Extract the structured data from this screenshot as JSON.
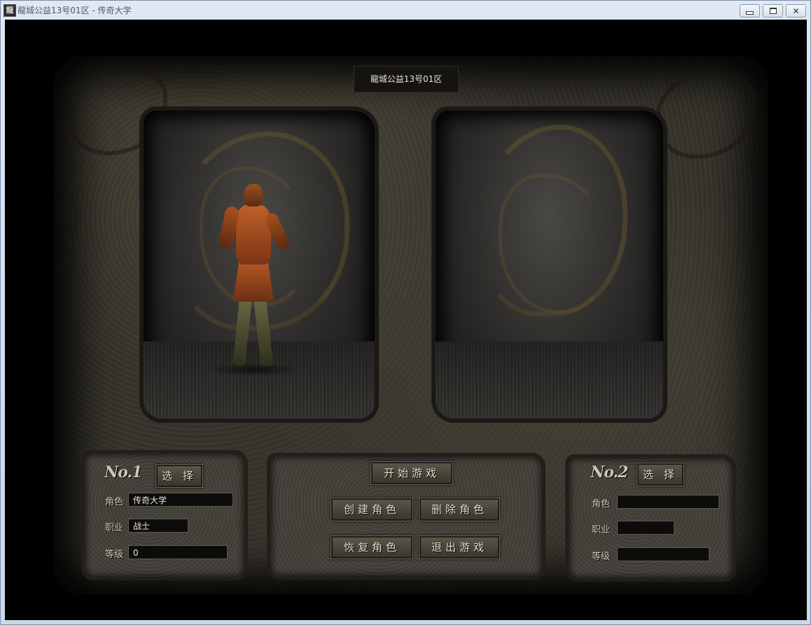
{
  "window": {
    "title": "龍城公益13号01区 - 传奇大学",
    "icon_glyph": "龍",
    "controls": {
      "minimize": "",
      "maximize": "",
      "close": "✕"
    }
  },
  "server": {
    "name": "龍城公益13号01区"
  },
  "slot1": {
    "number": "No.1",
    "select_label": "选 择",
    "role_label": "角色",
    "role_value": "传奇大学",
    "job_label": "职业",
    "job_value": "战士",
    "level_label": "等级",
    "level_value": "0"
  },
  "slot2": {
    "number": "No.2",
    "select_label": "选 择",
    "role_label": "角色",
    "role_value": "",
    "job_label": "职业",
    "job_value": "",
    "level_label": "等级",
    "level_value": ""
  },
  "actions": {
    "start": "开始游戏",
    "create": "创建角色",
    "delete": "删除角色",
    "restore": "恢复角色",
    "exit": "退出游戏"
  }
}
